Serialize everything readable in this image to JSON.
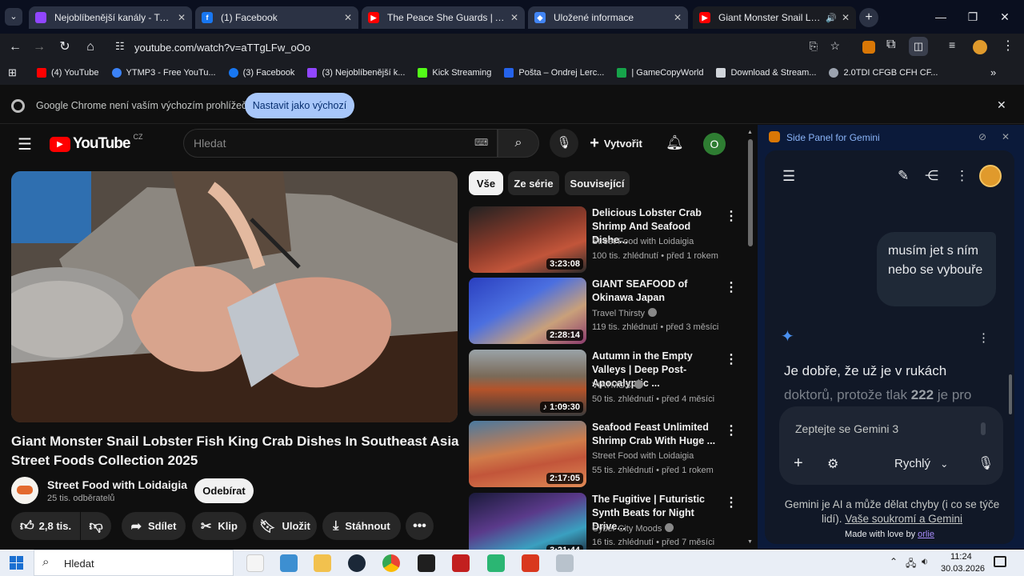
{
  "browser": {
    "tabs": [
      {
        "title": "Nejoblíbenější kanály - Twitch",
        "color": "#9146ff",
        "glyph": "t"
      },
      {
        "title": "(1) Facebook",
        "color": "#1877f2",
        "glyph": "f"
      },
      {
        "title": "The Peace She Guards | Ambien",
        "color": "#ff0000",
        "glyph": "▶"
      },
      {
        "title": "Uložené informace",
        "color": "#4285f4",
        "glyph": "◆"
      },
      {
        "title": "Giant Monster Snail Lobster",
        "color": "#ff0000",
        "glyph": "▶"
      }
    ],
    "new_tab": "+",
    "url": "youtube.com/watch?v=aTTgLFw_oOo",
    "bookmarks": [
      {
        "label": "(4) YouTube",
        "color": "#ff0000"
      },
      {
        "label": "YTMP3 - Free YouTu...",
        "color": "#3b82f6"
      },
      {
        "label": "(3) Facebook",
        "color": "#1877f2"
      },
      {
        "label": "(3) Nejoblíbenější k...",
        "color": "#9146ff"
      },
      {
        "label": "Kick Streaming",
        "color": "#53fc18"
      },
      {
        "label": "Pošta – Ondrej Lerc...",
        "color": "#2563eb"
      },
      {
        "label": "| GameCopyWorld",
        "color": "#16a34a"
      },
      {
        "label": "Download & Stream...",
        "color": "#d1d5db"
      },
      {
        "label": "2.0TDI CFGB CFH CF...",
        "color": "#9ca3af"
      }
    ],
    "infobar_text": "Google Chrome není vaším výchozím prohlížečem",
    "infobar_button": "Nastavit jako výchozí"
  },
  "youtube": {
    "logo_text": "YouTube",
    "region": "CZ",
    "search_placeholder": "Hledat",
    "create_label": "Vytvořit",
    "avatar_letter": "O",
    "video_title": "Giant Monster Snail Lobster Fish King Crab Dishes In Southeast Asia Street Foods Collection 2025",
    "channel": "Street Food with Loidaigia",
    "subscribers": "25 tis. odběratelů",
    "subscribe_label": "Odebírat",
    "likes": "2,8 tis.",
    "share_label": "Sdílet",
    "clip_label": "Klip",
    "save_label": "Uložit",
    "download_label": "Stáhnout",
    "chips": [
      "Vše",
      "Ze série",
      "Související"
    ],
    "recommendations": [
      {
        "title": "Delicious Lobster Crab Shrimp And Seafood Dishe...",
        "channel": "Street Food with Loidaigia",
        "meta": "100 tis. zhlédnutí • před 1 rokem",
        "duration": "3:23:08",
        "thumb_color": "#8a3a2a",
        "verified": false
      },
      {
        "title": "GIANT SEAFOOD of Okinawa Japan",
        "channel": "Travel Thirsty",
        "meta": "119 tis. zhlédnutí • před 3 měsíci",
        "duration": "2:28:14",
        "thumb_color": "#3b5bc9",
        "verified": true
      },
      {
        "title": "Autumn in the Empty Valleys | Deep Post-Apocalyptic ...",
        "channel": "VIATMOS",
        "meta": "50 tis. zhlédnutí • před 4 měsíci",
        "duration": "1:09:30",
        "thumb_color": "#6b5a4a",
        "verified": true
      },
      {
        "title": "Seafood Feast Unlimited Shrimp Crab With Huge ...",
        "channel": "Street Food with Loidaigia",
        "meta": "55 tis. zhlédnutí • před 1 rokem",
        "duration": "2:17:05",
        "thumb_color": "#b05a3a",
        "verified": false
      },
      {
        "title": "The Fugitive | Futuristic Synth Beats for Night Drive...",
        "channel": "Cyber City Moods",
        "meta": "16 tis. zhlédnutí • před 7 měsíci",
        "duration": "3:21:44",
        "thumb_color": "#3a2a5a",
        "verified": true
      }
    ]
  },
  "gemini": {
    "panel_title": "Side Panel for Gemini",
    "user_message": "musím jet s ním nebo se vybouře",
    "response_line1": "Je dobře, že už je v rukách",
    "response_line2_a": "doktorů, protože tlak ",
    "response_line2_b": "222",
    "response_line2_c": " je pro",
    "input_placeholder": "Zeptejte se Gemini 3",
    "mode_label": "Rychlý",
    "disclaimer": "Gemini je AI a může dělat chyby (i co se týče lidí).",
    "privacy_link": "Vaše soukromí a Gemini",
    "footer_prefix": "Made with love by ",
    "footer_link": "orlie"
  },
  "taskbar": {
    "search_placeholder": "Hledat",
    "time": "11:24",
    "date": "30.03.2026"
  }
}
